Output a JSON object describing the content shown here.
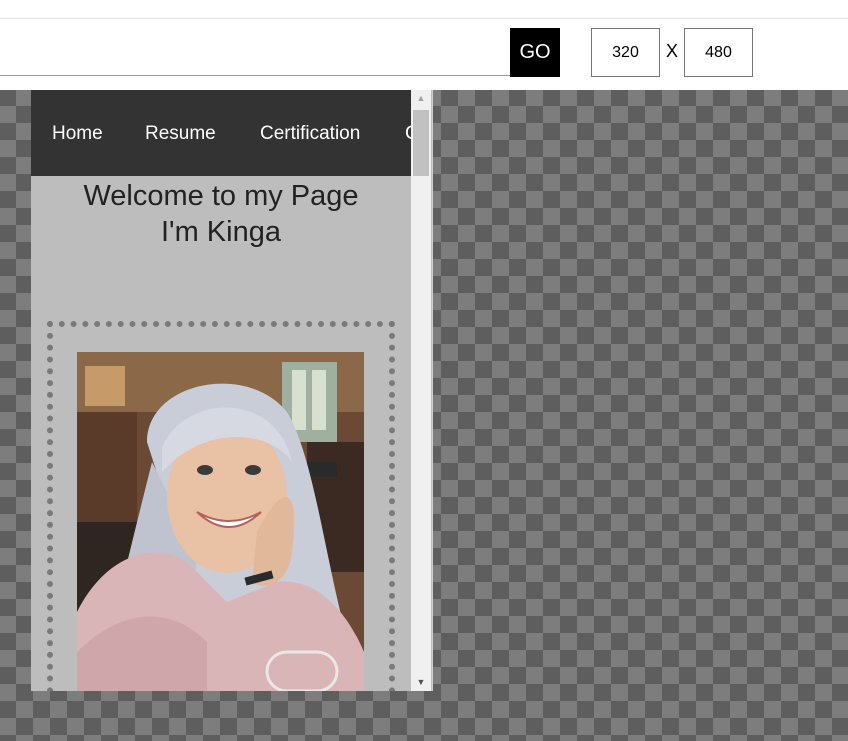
{
  "toolbar": {
    "url_value": "",
    "go_label": "GO",
    "width_value": "320",
    "separator": "X",
    "height_value": "480"
  },
  "preview": {
    "nav": [
      "Home",
      "Resume",
      "Certification",
      "C"
    ],
    "welcome_line1": "Welcome to my Page",
    "welcome_line2": "I'm Kinga"
  },
  "colors": {
    "nav_background": "#333333",
    "page_background": "#bdbdbd",
    "go_button": "#000000"
  },
  "icons": {
    "scroll_up": "triangle-up",
    "scroll_down": "triangle-down"
  }
}
